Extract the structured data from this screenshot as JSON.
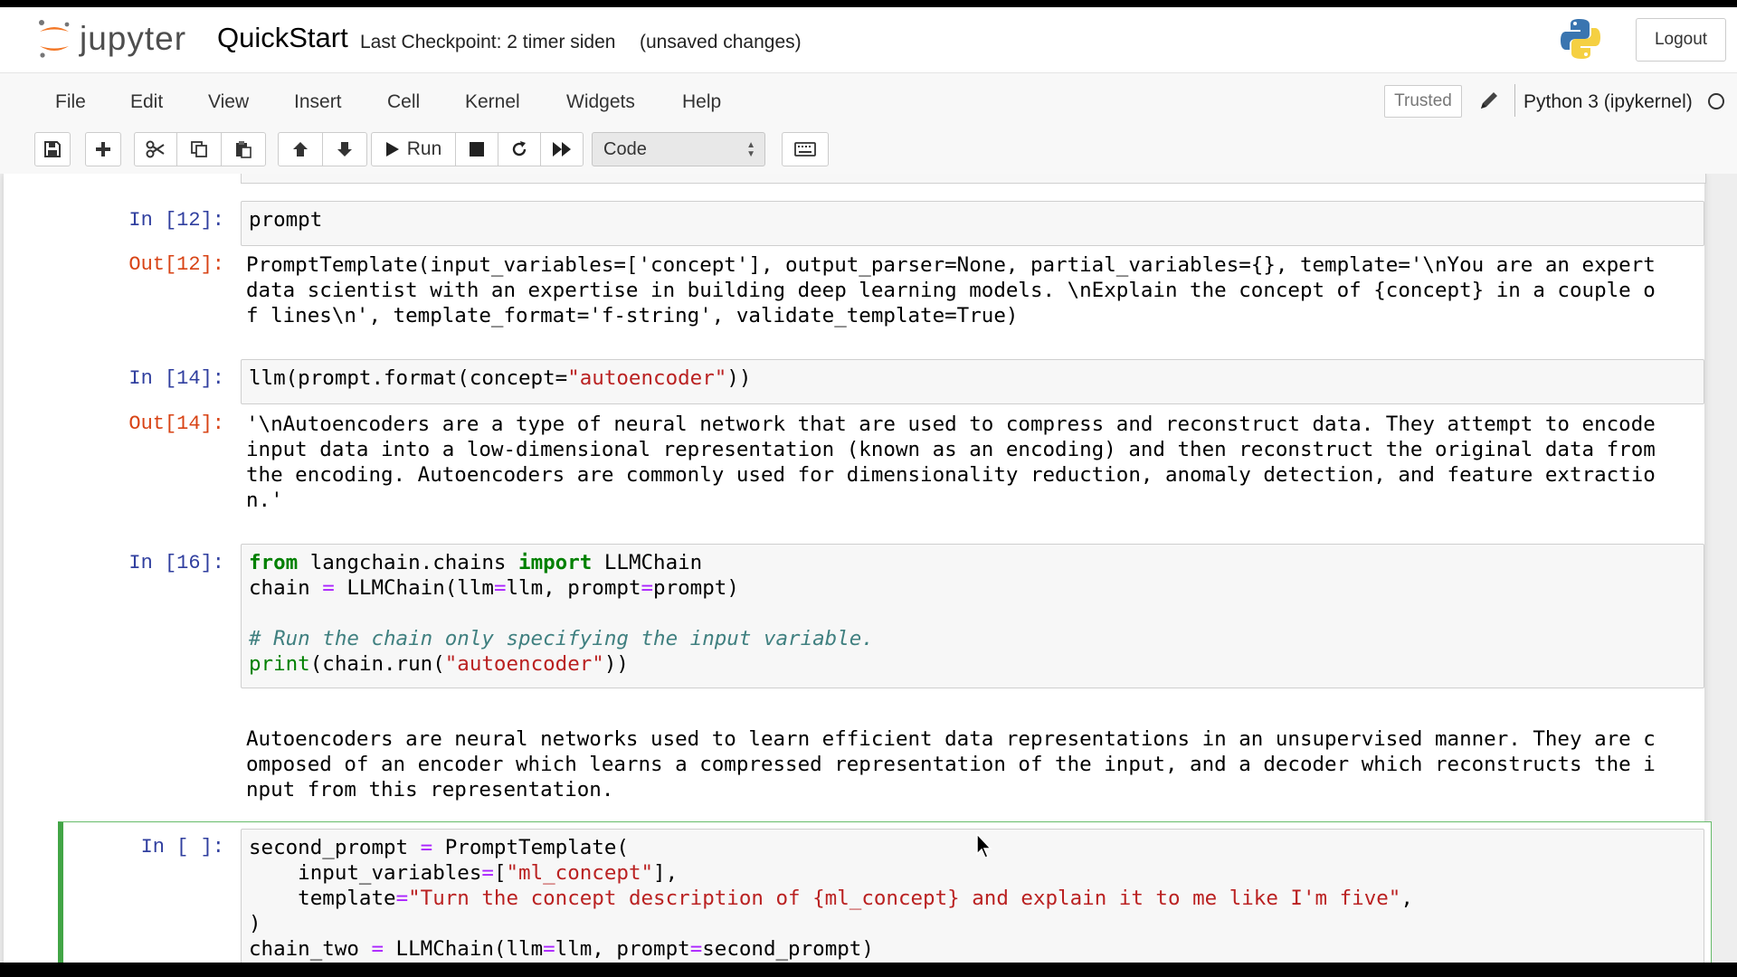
{
  "header": {
    "logo_text": "jupyter",
    "notebook_name": "QuickStart",
    "checkpoint": "Last Checkpoint: 2 timer siden",
    "autosave_status": "(unsaved changes)",
    "logout_label": "Logout"
  },
  "menubar": {
    "items": [
      "File",
      "Edit",
      "View",
      "Insert",
      "Cell",
      "Kernel",
      "Widgets",
      "Help"
    ],
    "trusted_label": "Trusted",
    "kernel_name": "Python 3 (ipykernel)"
  },
  "toolbar": {
    "run_label": "Run",
    "cell_type": "Code",
    "icons": [
      "save-icon",
      "plus-icon",
      "scissors-icon",
      "copy-icon",
      "paste-icon",
      "arrow-up-icon",
      "arrow-down-icon",
      "run-icon",
      "stop-icon",
      "restart-icon",
      "fast-forward-icon",
      "keyboard-icon"
    ]
  },
  "cells": {
    "c12": {
      "in_prompt": "In [12]:",
      "code": [
        "prompt"
      ],
      "out_prompt": "Out[12]:",
      "output": [
        "PromptTemplate(input_variables=['concept'], output_parser=None, partial_variables={}, template='\\nYou are an expert",
        "data scientist with an expertise in building deep learning models. \\nExplain the concept of {concept} in a couple o",
        "f lines\\n', template_format='f-string', validate_template=True)"
      ]
    },
    "c14": {
      "in_prompt": "In [14]:",
      "code_parts": [
        "llm(prompt.format(concept=",
        "\"autoencoder\"",
        "))"
      ],
      "out_prompt": "Out[14]:",
      "output": [
        "'\\nAutoencoders are a type of neural network that are used to compress and reconstruct data. They attempt to encode",
        "input data into a low-dimensional representation (known as an encoding) and then reconstruct the original data from",
        "the encoding. Autoencoders are commonly used for dimensionality reduction, anomaly detection, and feature extractio",
        "n.'"
      ]
    },
    "c16": {
      "in_prompt": "In [16]:",
      "line1": [
        "from",
        " langchain.chains ",
        "import",
        " LLMChain"
      ],
      "line2": [
        "chain ",
        "=",
        " LLMChain(llm",
        "=",
        "llm, prompt",
        "=",
        "prompt)"
      ],
      "line3": "# Run the chain only specifying the input variable.",
      "line4": [
        "print",
        "(chain.run(",
        "\"autoencoder\"",
        "))"
      ],
      "output": [
        "Autoencoders are neural networks used to learn efficient data representations in an unsupervised manner. They are c",
        "omposed of an encoder which learns a compressed representation of the input, and a decoder which reconstructs the i",
        "nput from this representation."
      ]
    },
    "cnew": {
      "in_prompt": "In [ ]:",
      "line1": [
        "second_prompt ",
        "=",
        " PromptTemplate("
      ],
      "line2": [
        "    input_variables",
        "=",
        "[",
        "\"ml_concept\"",
        "],"
      ],
      "line3": [
        "    template",
        "=",
        "\"Turn the concept description of {ml_concept} and explain it to me like I'm five\"",
        ","
      ],
      "line4": ")",
      "line5": [
        "chain_two ",
        "=",
        " LLMChain(llm",
        "=",
        "llm, prompt",
        "=",
        "second_prompt)"
      ]
    }
  },
  "colors": {
    "in_prompt": "#303f9f",
    "out_prompt": "#d84315",
    "keyword": "#008000",
    "string": "#ba2121",
    "operator": "#aa22ff",
    "comment": "#408080",
    "selected_cell_border": "#42a546"
  }
}
